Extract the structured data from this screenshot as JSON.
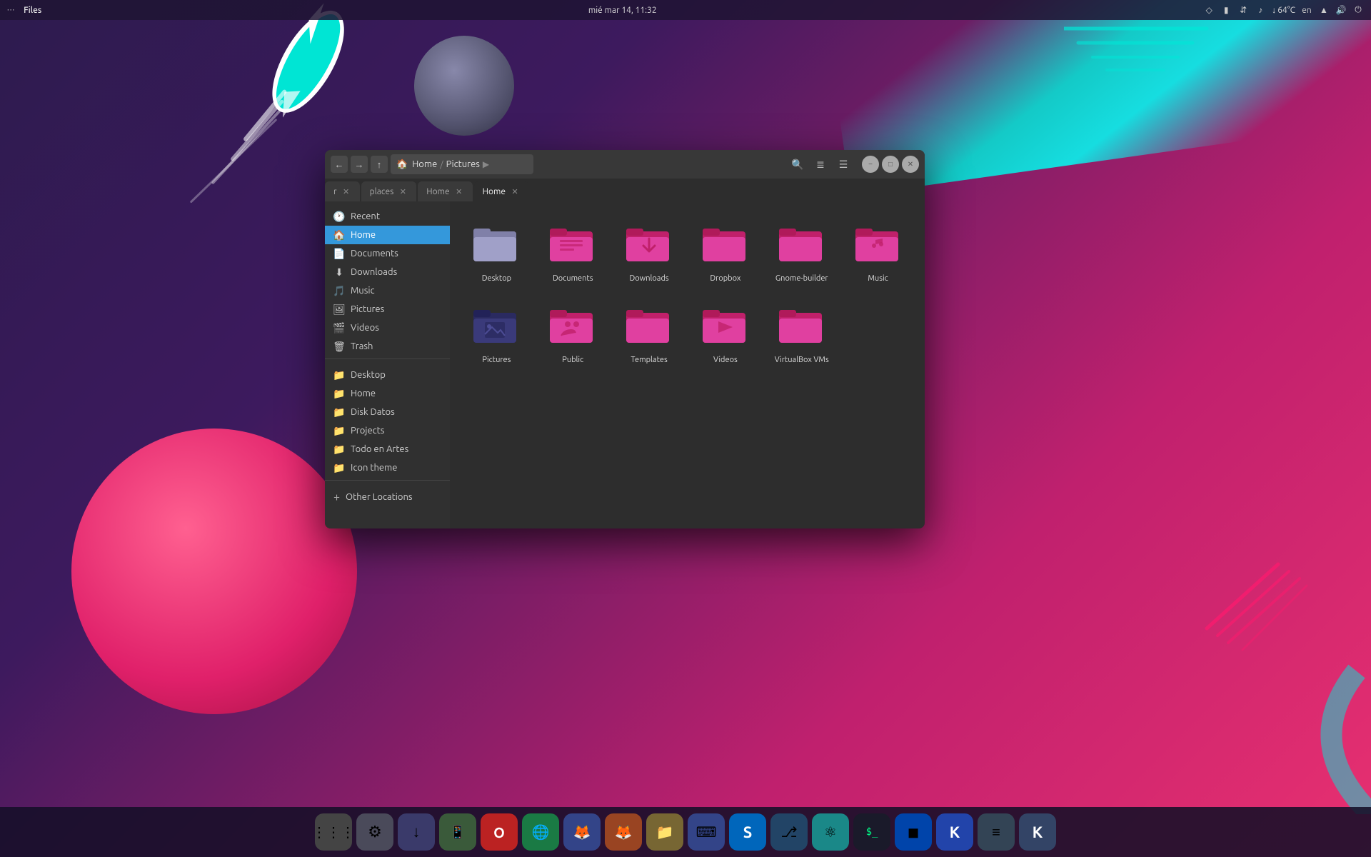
{
  "topbar": {
    "dots": "···",
    "appname": "Files",
    "datetime": "mié mar 14, 11:32",
    "temp": "64°C",
    "locale": "en"
  },
  "window": {
    "title": "Files",
    "tabs": [
      {
        "label": "r",
        "active": false
      },
      {
        "label": "places",
        "active": false
      },
      {
        "label": "Home",
        "active": false
      },
      {
        "label": "Home",
        "active": true
      }
    ],
    "breadcrumb": {
      "home": "Home",
      "sub": "Pictures"
    }
  },
  "sidebar": {
    "items": [
      {
        "id": "recent",
        "label": "Recent",
        "icon": "🕐",
        "active": false
      },
      {
        "id": "home",
        "label": "Home",
        "icon": "🏠",
        "active": true
      },
      {
        "id": "documents",
        "label": "Documents",
        "icon": "📄",
        "active": false
      },
      {
        "id": "downloads",
        "label": "Downloads",
        "icon": "⬇",
        "active": false
      },
      {
        "id": "music",
        "label": "Music",
        "icon": "🎵",
        "active": false
      },
      {
        "id": "pictures",
        "label": "Pictures",
        "icon": "🖼",
        "active": false
      },
      {
        "id": "videos",
        "label": "Videos",
        "icon": "🎬",
        "active": false
      },
      {
        "id": "trash",
        "label": "Trash",
        "icon": "🗑",
        "active": false
      },
      {
        "id": "desktop",
        "label": "Desktop",
        "icon": "📁",
        "active": false
      },
      {
        "id": "home2",
        "label": "Home",
        "icon": "📁",
        "active": false
      },
      {
        "id": "disk-datos",
        "label": "Disk Datos",
        "icon": "📁",
        "active": false
      },
      {
        "id": "projects",
        "label": "Projects",
        "icon": "📁",
        "active": false
      },
      {
        "id": "todo",
        "label": "Todo en Artes",
        "icon": "📁",
        "active": false
      },
      {
        "id": "icon-theme",
        "label": "Icon theme",
        "icon": "📁",
        "active": false
      }
    ],
    "other_locations": "Other Locations"
  },
  "files": [
    {
      "name": "Desktop",
      "color_class": "fc-desktop",
      "type": "folder"
    },
    {
      "name": "Documents",
      "color_class": "fc-documents",
      "type": "folder"
    },
    {
      "name": "Downloads",
      "color_class": "fc-downloads",
      "type": "folder-download"
    },
    {
      "name": "Dropbox",
      "color_class": "fc-dropbox",
      "type": "folder"
    },
    {
      "name": "Gnome-builder",
      "color_class": "fc-gnome",
      "type": "folder"
    },
    {
      "name": "Music",
      "color_class": "fc-music",
      "type": "folder"
    },
    {
      "name": "Pictures",
      "color_class": "fc-pictures",
      "type": "folder"
    },
    {
      "name": "Public",
      "color_class": "fc-public",
      "type": "folder"
    },
    {
      "name": "Templates",
      "color_class": "fc-templates",
      "type": "folder"
    },
    {
      "name": "Videos",
      "color_class": "fc-videos",
      "type": "folder"
    },
    {
      "name": "VirtualBox VMs",
      "color_class": "fc-virtualbox",
      "type": "folder"
    }
  ],
  "dock": {
    "items": [
      {
        "id": "apps",
        "label": "⊞",
        "color": "#555"
      },
      {
        "id": "settings",
        "label": "⚙",
        "color": "#667"
      },
      {
        "id": "install",
        "label": "↓",
        "color": "#446"
      },
      {
        "id": "phone-manager",
        "label": "📱",
        "color": "#353"
      },
      {
        "id": "opera",
        "label": "O",
        "color": "#c00"
      },
      {
        "id": "chrome",
        "label": "◎",
        "color": "#2a8"
      },
      {
        "id": "firefox-dev",
        "label": "🦊",
        "color": "#e60"
      },
      {
        "id": "firefox",
        "label": "🦊",
        "color": "#d44"
      },
      {
        "id": "files",
        "label": "📁",
        "color": "#774"
      },
      {
        "id": "devhelp",
        "label": "⌨",
        "color": "#446"
      },
      {
        "id": "skype",
        "label": "S",
        "color": "#00a"
      },
      {
        "id": "git",
        "label": "⎇",
        "color": "#246"
      },
      {
        "id": "atom",
        "label": "⚛",
        "color": "#2aa"
      },
      {
        "id": "terminal",
        "label": "$_",
        "color": "#222"
      },
      {
        "id": "blue",
        "label": "◼",
        "color": "#04a"
      },
      {
        "id": "krita",
        "label": "K",
        "color": "#24a"
      },
      {
        "id": "taskwarrior",
        "label": "≡",
        "color": "#445"
      },
      {
        "id": "kdenlive",
        "label": "K",
        "color": "#446"
      }
    ]
  }
}
